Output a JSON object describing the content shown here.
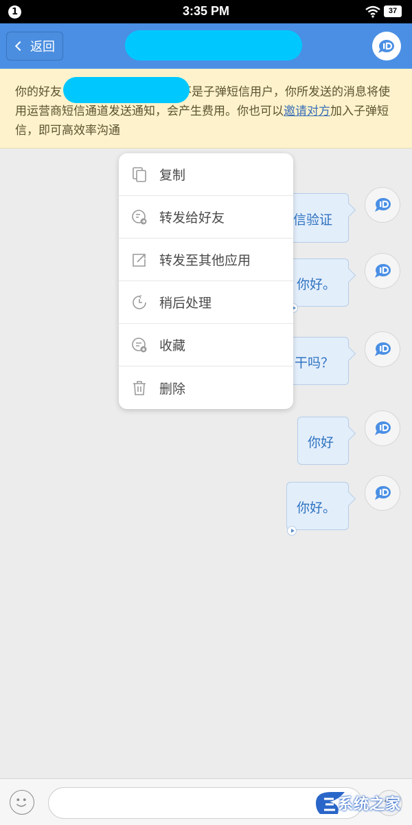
{
  "status_bar": {
    "notification_count": "1",
    "time": "3:35 PM",
    "battery": "37"
  },
  "header": {
    "back_label": "返回",
    "title_redacted": true,
    "avatar_icon": "message-bubble-icon"
  },
  "notice": {
    "text_before": "你的好友",
    "text_middle": "不是子弹短信用户，你所发送的消息将使用运营商短信通道发送通知，会产生费用。你也可以",
    "link": "邀请对方",
    "text_after": "加入子弹短信，即可高效率沟通"
  },
  "messages": [
    {
      "text": "信验证"
    },
    {
      "text": "你好。"
    },
    {
      "text": "干吗？"
    },
    {
      "text": "你好"
    },
    {
      "text": "你好。"
    }
  ],
  "context_menu": {
    "items": [
      {
        "label": "复制",
        "icon": "copy-icon"
      },
      {
        "label": "转发给好友",
        "icon": "forward-friend-icon"
      },
      {
        "label": "转发至其他应用",
        "icon": "share-external-icon"
      },
      {
        "label": "稍后处理",
        "icon": "clock-later-icon"
      },
      {
        "label": "收藏",
        "icon": "favorite-icon"
      },
      {
        "label": "删除",
        "icon": "trash-icon"
      }
    ]
  },
  "input_bar": {
    "placeholder": "",
    "emoji_icon": "emoji-icon",
    "send_icon": "send-arrow-icon"
  },
  "watermark": {
    "text": "系统之家"
  },
  "colors": {
    "header": "#4a8fe4",
    "notice_bg": "#fdf2cb",
    "bubble_bg": "#e3eefb",
    "bubble_text": "#2e73c0",
    "redaction": "#00c8ff"
  }
}
